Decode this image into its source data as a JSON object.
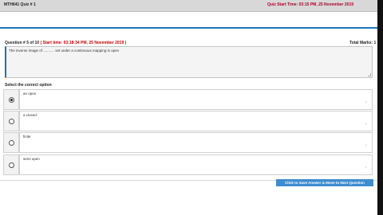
{
  "header": {
    "quiz_title": "MTH641 Quiz # 1",
    "quiz_start": "Quiz Start Time: 03:15 PM, 25 November 2019"
  },
  "question": {
    "number_label": "Question # 5 of 10",
    "start_time": "( Start time: 03:18:34 PM, 25 November 2019 )",
    "total_marks_label": "Total Marks: 1",
    "text": "The inverse image of ........... set under a continuous mapping is open"
  },
  "options_heading": "Select the correct option",
  "options": [
    {
      "label": "an open",
      "selected": true
    },
    {
      "label": "a closed",
      "selected": false
    },
    {
      "label": "finite",
      "selected": false
    },
    {
      "label": "semi open",
      "selected": false
    }
  ],
  "footer": {
    "save_next_label": "Click to Save Answer & Move to Next Question"
  },
  "colors": {
    "accent": "#1a73b7",
    "warning_red": "#c00000",
    "button": "#3f8ccf"
  }
}
